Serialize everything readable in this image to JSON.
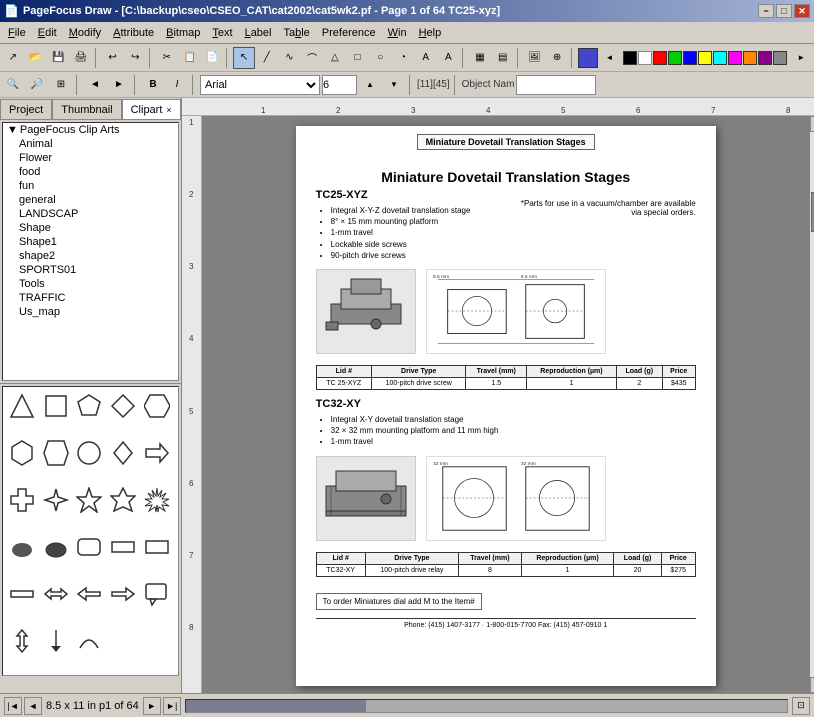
{
  "titlebar": {
    "title": "PageFocus Draw - [C:\\backup\\cseo\\CSEO_CAT\\cat2002\\cat5wk2.pf - Page 1 of 64 TC25-xyz]",
    "icon": "pf-icon",
    "min_btn": "−",
    "max_btn": "□",
    "close_btn": "✕"
  },
  "menubar": {
    "items": [
      "File",
      "Edit",
      "Modify",
      "Attribute",
      "Bitmap",
      "Text",
      "Label",
      "Table",
      "Preference",
      "Win",
      "Help"
    ]
  },
  "tabs": {
    "project": "Project",
    "thumbnail": "Thumbnail",
    "clipart": "Clipart",
    "close": "×"
  },
  "tree": {
    "root": "PageFocus Clip Arts",
    "items": [
      {
        "label": "Animal",
        "level": 1
      },
      {
        "label": "Flower",
        "level": 1,
        "selected": true
      },
      {
        "label": "food",
        "level": 1
      },
      {
        "label": "fun",
        "level": 1
      },
      {
        "label": "general",
        "level": 1
      },
      {
        "label": "LANDSCAP",
        "level": 1
      },
      {
        "label": "Shape",
        "level": 1
      },
      {
        "label": "Shape1",
        "level": 1
      },
      {
        "label": "shape2",
        "level": 1
      },
      {
        "label": "SPORTS01",
        "level": 1
      },
      {
        "label": "Tools",
        "level": 1
      },
      {
        "label": "TRAFFIC",
        "level": 1
      },
      {
        "label": "Us_map",
        "level": 1
      }
    ]
  },
  "toolbar1": {
    "buttons": [
      "↗",
      "↩",
      "↪",
      "~",
      "∫",
      "∂",
      "→",
      "←",
      "↑",
      "↓",
      "▷",
      "◁",
      "△",
      "▽",
      "⬡",
      "○",
      "□",
      "◇",
      "▷",
      "⊓",
      "A",
      "A",
      "▦",
      "▤",
      "▣",
      "⊞",
      "⊟",
      "⊕",
      "⊗",
      "🔍",
      "🔍",
      "📋",
      "💾",
      "🖨"
    ]
  },
  "toolbar2": {
    "zoom_in": "🔍+",
    "zoom_out": "🔍-",
    "fit": "⊞",
    "page_nav": "📄",
    "bold": "B",
    "italic": "I",
    "font_name": "Arial",
    "font_size": "6",
    "coords": "[11][45]",
    "obj_name_label": "Object Nam"
  },
  "rulers": {
    "h_marks": [
      "1",
      "2",
      "3",
      "4",
      "5",
      "6",
      "7",
      "8"
    ],
    "v_marks": [
      "1",
      "2",
      "3",
      "4",
      "5",
      "6",
      "7",
      "8"
    ]
  },
  "page": {
    "header_label": "Miniature Dovetail Translation Stages",
    "title": "Miniature Dovetail Translation Stages",
    "subtitle": "*Parts for use in a vacuum/chamber are available via special orders.",
    "section1_id": "TC25-XYZ",
    "section1_bullets": [
      "Integral X-Y-Z dovetail translation stage",
      "8° × 15 mm mounting platform",
      "1-mm travel",
      "Lockable side screws",
      "90-pitch drive screws"
    ],
    "section1_table_headers": [
      "Lid #",
      "Drive Type",
      "Travel (mm)",
      "Reproduction (µm)",
      "Load (g)",
      "Price"
    ],
    "section1_table_rows": [
      [
        "TC 25-XYZ",
        "100-pitch drive screw",
        "1.5",
        "1",
        "2",
        "$435"
      ]
    ],
    "section2_id": "TC32-XY",
    "section2_bullets": [
      "Integral X-Y dovetail translation stage",
      "32 × 32 mm mounting platform and 11 mm high",
      "1-mm travel"
    ],
    "section2_table_headers": [
      "Lid #",
      "Drive Type",
      "Travel (mm)",
      "Reproduction (µm)",
      "Load (g)",
      "Price"
    ],
    "section2_table_rows": [
      [
        "TC32-XY",
        "100-pitch drive relay",
        "8",
        "1",
        "20",
        "$275"
      ]
    ],
    "order_note": "To order Miniatures dial add M to the Item#",
    "footer": "Phone: (415) 1407-3177  ·  1-800-015-7700         Fax: (415) 457-0910                    1"
  },
  "statusbar": {
    "page_info": "8.5 x 11 in  p1 of 64",
    "nav_first": "|◄",
    "nav_prev": "◄",
    "nav_next": "►",
    "nav_last": "►|"
  },
  "right_tools": {
    "buttons": [
      "↖",
      "↗",
      "↙",
      "↘",
      "→",
      "←",
      "↑",
      "↓",
      "↔",
      "↕",
      "↗",
      "↙",
      "◎",
      "⊕",
      "⊗",
      "□",
      "△",
      "○",
      "◇",
      "▷",
      "⊞",
      "⊟",
      "⊕",
      "⊗",
      "↺",
      "↻",
      "⌖",
      "⊡",
      "⊞",
      "⊟",
      "▦",
      "▤",
      "▣",
      "⊓"
    ]
  }
}
